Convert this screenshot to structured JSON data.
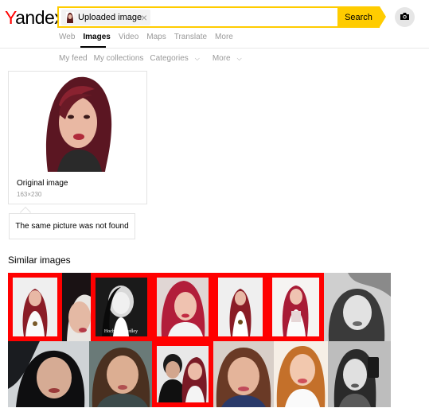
{
  "logo": {
    "first": "Y",
    "rest": "andex"
  },
  "search": {
    "chip_label": "Uploaded image",
    "close_glyph": "×",
    "button_label": "Search"
  },
  "nav": {
    "items": [
      "Web",
      "Images",
      "Video",
      "Maps",
      "Translate",
      "More"
    ],
    "active": "Images"
  },
  "subnav": {
    "items": [
      "My feed",
      "My collections",
      "Categories",
      "More"
    ],
    "caret": "⌵"
  },
  "original": {
    "title": "Original image",
    "size": "163×230"
  },
  "not_found": "The same picture was not found",
  "similar": {
    "title": "Similar images",
    "tiles": [
      {
        "name": "similar-image-1",
        "highlighted": true
      },
      {
        "name": "similar-image-2",
        "highlighted": false
      },
      {
        "name": "similar-image-3",
        "highlighted": true,
        "caption": "Ciera Hochrein Medley"
      },
      {
        "name": "similar-image-4",
        "highlighted": true
      },
      {
        "name": "similar-image-5",
        "highlighted": true
      },
      {
        "name": "similar-image-6",
        "highlighted": true
      },
      {
        "name": "similar-image-7",
        "highlighted": false
      },
      {
        "name": "similar-image-8",
        "highlighted": false
      },
      {
        "name": "similar-image-9",
        "highlighted": false
      },
      {
        "name": "similar-image-10",
        "highlighted": true
      },
      {
        "name": "similar-image-11",
        "highlighted": false
      },
      {
        "name": "similar-image-12",
        "highlighted": false
      },
      {
        "name": "similar-image-13",
        "highlighted": false
      }
    ]
  },
  "colors": {
    "accent": "#ffcc00",
    "highlight": "#ff0000",
    "brand_red": "#ff0000"
  }
}
